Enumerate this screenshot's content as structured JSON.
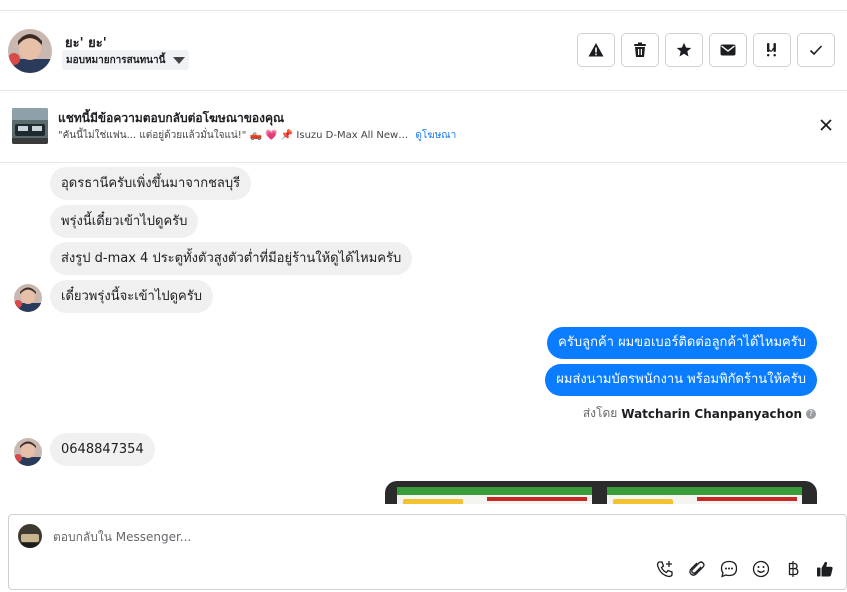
{
  "header": {
    "contact_name": "ยะ' ยะ'",
    "assign_label": "มอบหมายการสนทนานี้",
    "actions": [
      {
        "icon": "warning-icon",
        "label": "Mark as spam"
      },
      {
        "icon": "trash-icon",
        "label": "Delete"
      },
      {
        "icon": "star-icon",
        "label": "Follow up"
      },
      {
        "icon": "envelope-icon",
        "label": "Mark as unread"
      },
      {
        "icon": "priority-icon",
        "label": "Priority"
      },
      {
        "icon": "check-icon",
        "label": "Mark as done"
      }
    ]
  },
  "ad_banner": {
    "title": "แชทนี้มีข้อความตอบกลับต่อโฆษณาของคุณ",
    "snippet": "\"คันนี้ไม่ใช่แฟน... แต่อยู่ด้วยแล้วมั่นใจแน่!\" 🛻 💗 📌 Isuzu D-Max All New…",
    "link_label": "ดูโฆษณา"
  },
  "messages": {
    "incoming": [
      "อุดรธานีครับเพิ่งขึ้นมาจากชลบุรี",
      "พรุ่งนี้เดี๋ยวเข้าไปดูครับ",
      "ส่งรูป d-max 4 ประตูทั้งตัวสูงตัวต่ำที่มีอยู่ร้านให้ดูได้ไหมครับ",
      "เดี๋ยวพรุ่งนี้จะเข้าไปดูครับ",
      "0648847354"
    ],
    "outgoing": [
      "ครับลูกค้า ผมขอเบอร์ติดต่อลูกค้าได้ไหมครับ",
      "ผมส่งนามบัตรพนักงาน พร้อมพิกัดร้านให้ครับ"
    ],
    "sent_by_prefix": "ส่งโดย",
    "sent_by_name": "Watcharin Chanpanyachon",
    "info_glyph": "?"
  },
  "composer": {
    "placeholder": "ตอบกลับใน Messenger...",
    "value": "",
    "tools": [
      "add-call-icon",
      "attach-icon",
      "saved-reply-icon",
      "emoji-icon",
      "baht-payment-icon",
      "thumbs-up-icon"
    ]
  },
  "colors": {
    "outgoing_bubble": "#0a7cff",
    "incoming_bubble": "#f0f0f0",
    "link": "#1877f2"
  }
}
